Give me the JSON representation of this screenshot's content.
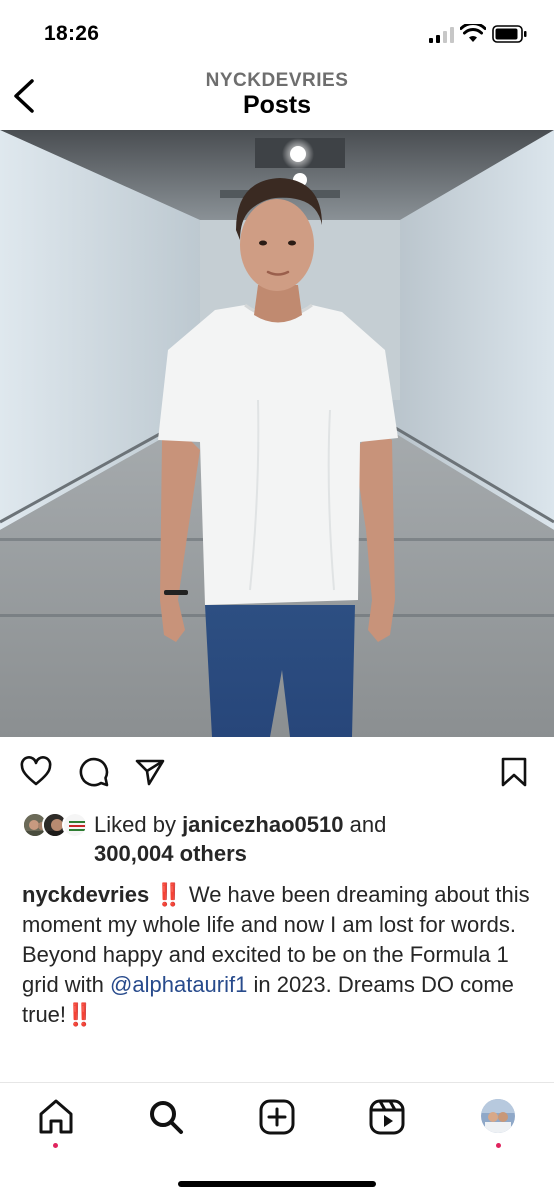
{
  "status_bar": {
    "time": "18:26",
    "icons": [
      "cellular-signal-icon",
      "wifi-icon",
      "battery-icon"
    ]
  },
  "header": {
    "username": "NYCKDEVRIES",
    "title": "Posts",
    "back_icon": "chevron-left-icon"
  },
  "post": {
    "image_description_icon": "photo",
    "actions": {
      "like_icon": "heart-icon",
      "comment_icon": "comment-icon",
      "share_icon": "paper-plane-icon",
      "save_icon": "bookmark-icon"
    },
    "likes": {
      "prefix": "Liked by ",
      "liker": "janicezhao0510",
      "conjunction": " and",
      "others": "300,004 others"
    },
    "caption": {
      "username": "nyckdevries",
      "emoji_start": " ‼️",
      "text_part1": " We have been dreaming about this moment my whole life and now I am lost for words. Beyond happy and excited to be on the Formula 1 grid with ",
      "mention": "@alphataurif1",
      "text_part2": " in 2023. Dreams DO come true!",
      "emoji_end": "‼️"
    }
  },
  "tab_bar": {
    "items": [
      {
        "name": "home",
        "icon": "home-icon",
        "has_dot": true
      },
      {
        "name": "search",
        "icon": "search-icon",
        "has_dot": false
      },
      {
        "name": "create",
        "icon": "plus-square-icon",
        "has_dot": false
      },
      {
        "name": "reels",
        "icon": "reels-icon",
        "has_dot": false
      },
      {
        "name": "profile",
        "icon": "profile-avatar-icon",
        "has_dot": true
      }
    ]
  },
  "colors": {
    "text": "#262626",
    "mention": "#284b8c",
    "notification_dot": "#e0245e",
    "emoji_red": "#d91c1c"
  }
}
